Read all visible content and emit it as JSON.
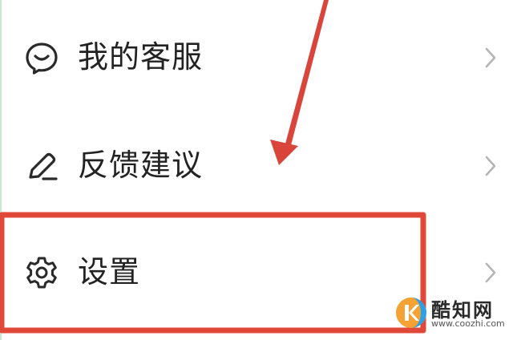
{
  "menu": {
    "items": [
      {
        "label": "我的客服",
        "icon": "customer-service-icon"
      },
      {
        "label": "反馈建议",
        "icon": "pencil-icon"
      },
      {
        "label": "设置",
        "icon": "gear-icon"
      }
    ]
  },
  "annotation": {
    "highlight_color": "#e0493a",
    "arrow_color": "#d9453a",
    "highlighted_item": "设置"
  },
  "watermark": {
    "name": "酷知网",
    "url": "www.coozhi.com",
    "logo_colors": [
      "#f3a233",
      "#2aa0e6"
    ]
  }
}
